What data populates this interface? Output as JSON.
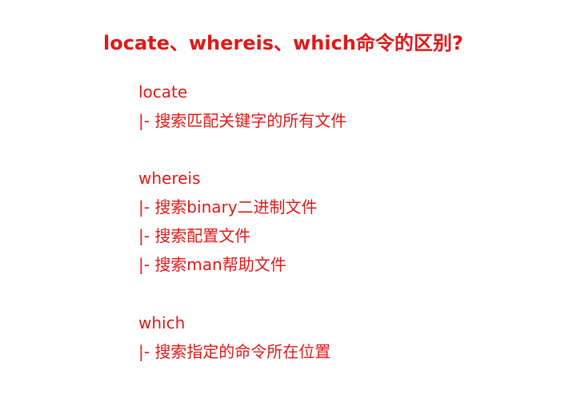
{
  "title": "locate、whereis、which命令的区别?",
  "sections": [
    {
      "name": "locate",
      "items": [
        "|- 搜索匹配关键字的所有文件"
      ]
    },
    {
      "name": "whereis",
      "items": [
        "|- 搜索binary二进制文件",
        "|- 搜索配置文件",
        "|- 搜索man帮助文件"
      ]
    },
    {
      "name": "which",
      "items": [
        "|- 搜索指定的命令所在位置"
      ]
    }
  ],
  "colors": {
    "text": "#e01818",
    "background": "#ffffff"
  }
}
